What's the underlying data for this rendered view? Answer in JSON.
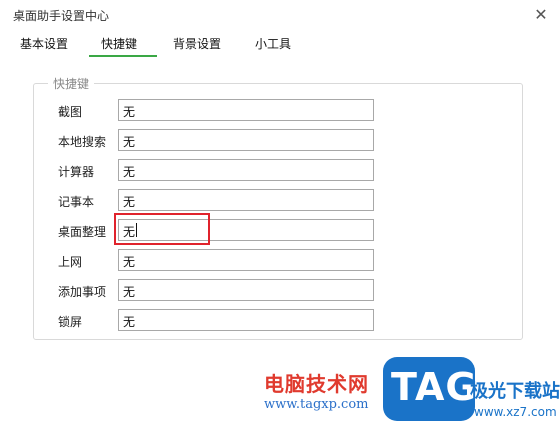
{
  "window": {
    "title": "桌面助手设置中心",
    "close_glyph": "✕"
  },
  "tabs": [
    {
      "label": "基本设置",
      "active": false
    },
    {
      "label": "快捷键",
      "active": true
    },
    {
      "label": "背景设置",
      "active": false
    },
    {
      "label": "小工具",
      "active": false
    }
  ],
  "colors": {
    "active_tab_underline": "#3aa845",
    "highlight_box": "#e0232c"
  },
  "shortcuts": {
    "group_title": "快捷键",
    "rows": [
      {
        "label": "截图",
        "value": "无"
      },
      {
        "label": "本地搜索",
        "value": "无"
      },
      {
        "label": "计算器",
        "value": "无"
      },
      {
        "label": "记事本",
        "value": "无"
      },
      {
        "label": "桌面整理",
        "value": "无"
      },
      {
        "label": "上网",
        "value": "无"
      },
      {
        "label": "添加事项",
        "value": "无"
      },
      {
        "label": "锁屏",
        "value": "无"
      }
    ]
  },
  "watermark": {
    "red_text": "电脑技术网",
    "url": "www.tagxp.com",
    "logo_text": "TAG",
    "site_text": "极光下载站",
    "site_url": "www.xz7.com"
  }
}
